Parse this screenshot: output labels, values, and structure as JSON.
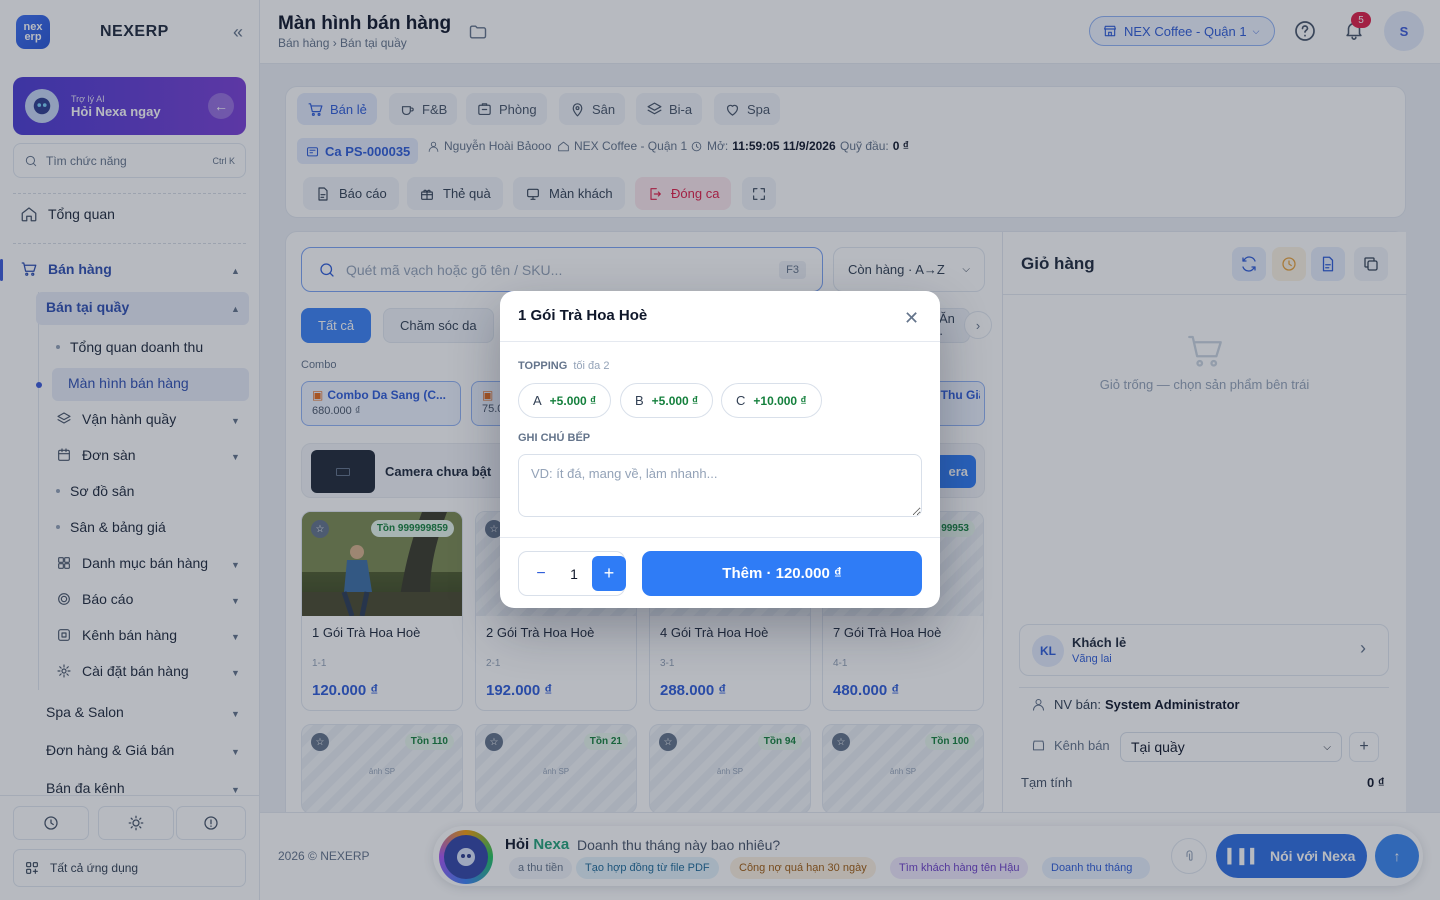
{
  "brand": {
    "logo_text": "nex erp",
    "name": "NEXERP"
  },
  "ai_card": {
    "subtitle": "Trợ lý AI",
    "title": "Hỏi Nexa ngay"
  },
  "sidebar_search": {
    "placeholder": "Tìm chức năng",
    "shortcut": "Ctrl K"
  },
  "sidebar": {
    "overview": "Tổng quan",
    "sales": "Bán hàng",
    "counter": "Bán tại quầy",
    "counter_items": [
      "Tổng quan doanh thu",
      "Màn hình bán hàng"
    ],
    "vanhanh": "Vận hành quầy",
    "donsan": "Đơn sàn",
    "sodo": "Sơ đồ sân",
    "sanbang": "Sân & bảng giá",
    "danhmuc": "Danh mục bán hàng",
    "baocao": "Báo cáo",
    "kenh": "Kênh bán hàng",
    "caidat": "Cài đặt bán hàng",
    "spa": "Spa & Salon",
    "donhang": "Đơn hàng & Giá bán",
    "multichannel": "Bán đa kênh",
    "all_apps": "Tất cả ứng dụng"
  },
  "header": {
    "title": "Màn hình bán hàng",
    "breadcrumb": "Bán hàng › Bán tại quầy",
    "store": "NEX Coffee - Quận 1",
    "notifications": "5",
    "avatar": "S"
  },
  "tabs": [
    "Bán lẻ",
    "F&B",
    "Phòng",
    "Sân",
    "Bi-a",
    "Spa"
  ],
  "shift": {
    "code": "Ca PS-000035",
    "staff": "Nguyễn Hoài Bảooo",
    "store": "NEX Coffee - Quận 1",
    "opened_label": "Mở:",
    "opened_value": "11:59:05 11/9/2026",
    "cash_label": "Quỹ đầu:",
    "cash_value": "0 ₫"
  },
  "actions": [
    "Báo cáo",
    "Thẻ quà",
    "Màn khách",
    "Đóng ca"
  ],
  "search": {
    "placeholder": "Quét mã vạch hoặc gõ tên / SKU...",
    "shortcut": "F3"
  },
  "sort": {
    "value": "Còn hàng · A→Z"
  },
  "categories": [
    "Tất cả",
    "Chăm sóc da",
    "Ăn ·"
  ],
  "combo": {
    "label": "Combo",
    "items": [
      {
        "name": "Combo Da Sang (C...",
        "price": "680.000 ₫"
      },
      {
        "name": "",
        "price": "75.0"
      },
      {
        "name": "o Thu Giã",
        "price": ""
      }
    ]
  },
  "camera": {
    "label": "Camera chưa bật",
    "button": "era"
  },
  "products": [
    {
      "name": "1 Gói Trà Hoa Hoè",
      "sku": "1-1",
      "price": "120.000 ₫",
      "stock": "Tồn 999999859"
    },
    {
      "name": "2 Gói Trà Hoa Hoè",
      "sku": "2-1",
      "price": "192.000 ₫",
      "stock": ""
    },
    {
      "name": "4 Gói Trà Hoa Hoè",
      "sku": "3-1",
      "price": "288.000 ₫",
      "stock": ""
    },
    {
      "name": "7 Gói Trà Hoa Hoè",
      "sku": "4-1",
      "price": "480.000 ₫",
      "stock": "99953"
    }
  ],
  "product_row2": [
    {
      "stock": "Tồn 110",
      "img": "ảnh SP"
    },
    {
      "stock": "Tồn 21",
      "img": "ảnh SP"
    },
    {
      "stock": "Tồn 94",
      "img": "ảnh SP"
    },
    {
      "stock": "Tồn 100",
      "img": "ảnh SP"
    }
  ],
  "cart": {
    "title": "Giỏ hàng",
    "empty": "Giỏ trống — chọn sản phẩm bên trái",
    "customer_initials": "KL",
    "customer_name": "Khách lẻ",
    "customer_type": "Vãng lai",
    "seller_label": "NV bán:",
    "seller": "System Administrator",
    "channel_label": "Kênh bán",
    "channel_value": "Tại quầy",
    "subtotal_label": "Tạm tính",
    "subtotal": "0 ₫"
  },
  "footer": {
    "copyright": "2026 © NEXERP"
  },
  "assistant": {
    "ask": "Hỏi",
    "name": "Nexa",
    "prompt": "Doanh thu tháng này bao nhiêu?",
    "suggestions": [
      "a thu tiền",
      "Tạo hợp đồng từ file PDF",
      "Công nợ quá hạn 30 ngày",
      "Tìm khách hàng tên Hậu",
      "Doanh thu tháng"
    ],
    "voice_button": "Nói với Nexa"
  },
  "modal": {
    "title": "1 Gói Trà Hoa Hoè",
    "topping_label": "TOPPING",
    "topping_hint": "tối đa 2",
    "toppings": [
      {
        "name": "A",
        "price": "+5.000 ₫"
      },
      {
        "name": "B",
        "price": "+5.000 ₫"
      },
      {
        "name": "C",
        "price": "+10.000 ₫"
      }
    ],
    "note_label": "GHI CHÚ BẾP",
    "note_placeholder": "VD: ít đá, mang về, làm nhanh...",
    "quantity": "1",
    "add_button": "Thêm · 120.000 ₫"
  }
}
